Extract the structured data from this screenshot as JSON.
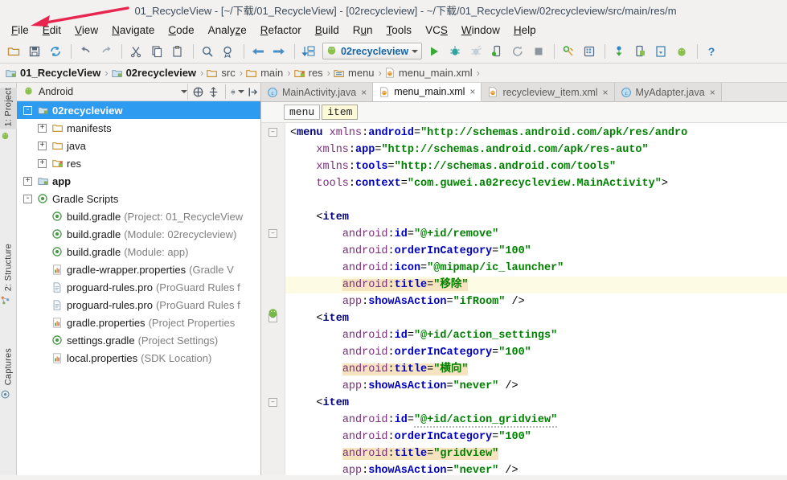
{
  "window": {
    "title": "01_RecycleView - [~/下载/01_RecycleView] - [02recycleview] - ~/下载/01_RecycleView/02recycleview/src/main/res/m"
  },
  "menubar": {
    "items": [
      {
        "label": "File",
        "mnemonic": "F"
      },
      {
        "label": "Edit",
        "mnemonic": "E"
      },
      {
        "label": "View",
        "mnemonic": "V"
      },
      {
        "label": "Navigate",
        "mnemonic": "N"
      },
      {
        "label": "Code",
        "mnemonic": "C"
      },
      {
        "label": "Analyze",
        "mnemonic": "z"
      },
      {
        "label": "Refactor",
        "mnemonic": "R"
      },
      {
        "label": "Build",
        "mnemonic": "B"
      },
      {
        "label": "Run",
        "mnemonic": "u"
      },
      {
        "label": "Tools",
        "mnemonic": "T"
      },
      {
        "label": "VCS",
        "mnemonic": "S"
      },
      {
        "label": "Window",
        "mnemonic": "W"
      },
      {
        "label": "Help",
        "mnemonic": "H"
      }
    ]
  },
  "toolbar": {
    "icons": [
      "open-folder-icon",
      "save-all-icon",
      "sync-refresh-icon",
      "undo-icon",
      "redo-icon",
      "cut-icon",
      "copy-icon",
      "paste-icon",
      "find-icon",
      "find-usages-icon",
      "back-icon",
      "forward-icon",
      "sort-icon"
    ],
    "run_config_label": "02recycleview",
    "right_icons": [
      "run-icon",
      "debug-icon",
      "coverage-icon",
      "attach-debugger-icon",
      "rerun-icon",
      "stop-icon",
      "sdk-manager-icon",
      "avd-manager-icon",
      "sync-gradle-icon",
      "device-explorer-icon",
      "layout-inspector-icon",
      "android-icon",
      "help-icon"
    ]
  },
  "breadcrumb": {
    "items": [
      {
        "label": "01_RecycleView",
        "icon": "module-icon",
        "bold": true
      },
      {
        "label": "02recycleview",
        "icon": "module-icon",
        "bold": true
      },
      {
        "label": "src",
        "icon": "folder-icon",
        "bold": false
      },
      {
        "label": "main",
        "icon": "folder-icon",
        "bold": false
      },
      {
        "label": "res",
        "icon": "res-folder-icon",
        "bold": false
      },
      {
        "label": "menu",
        "icon": "menu-folder-icon",
        "bold": false
      },
      {
        "label": "menu_main.xml",
        "icon": "xml-file-icon",
        "bold": false
      }
    ]
  },
  "toolstrip": {
    "items": [
      {
        "label": "1: Project",
        "icon": "android-icon",
        "active": true
      },
      {
        "label": "2: Structure",
        "icon": "structure-icon",
        "active": false
      },
      {
        "label": "Captures",
        "icon": "captures-icon",
        "active": false
      }
    ]
  },
  "project_panel": {
    "view_selector": "Android",
    "header_icons": [
      "collapse-all-icon",
      "expand-all-icon",
      "settings-gear-icon",
      "hide-panel-icon"
    ],
    "tree": [
      {
        "label": "02recycleview",
        "meta": "",
        "indent": 0,
        "toggle": "-",
        "icon": "module-icon",
        "selected": true,
        "bold": true
      },
      {
        "label": "manifests",
        "meta": "",
        "indent": 1,
        "toggle": "+",
        "icon": "folder-icon",
        "selected": false,
        "bold": false
      },
      {
        "label": "java",
        "meta": "",
        "indent": 1,
        "toggle": "+",
        "icon": "folder-icon",
        "selected": false,
        "bold": false
      },
      {
        "label": "res",
        "meta": "",
        "indent": 1,
        "toggle": "+",
        "icon": "res-folder-icon",
        "selected": false,
        "bold": false
      },
      {
        "label": "app",
        "meta": "",
        "indent": 0,
        "toggle": "+",
        "icon": "module-icon",
        "selected": false,
        "bold": true
      },
      {
        "label": "Gradle Scripts",
        "meta": "",
        "indent": 0,
        "toggle": "-",
        "icon": "gradle-icon",
        "selected": false,
        "bold": false
      },
      {
        "label": "build.gradle",
        "meta": "(Project: 01_RecycleView",
        "indent": 1,
        "toggle": "",
        "icon": "gradle-icon",
        "selected": false,
        "bold": false
      },
      {
        "label": "build.gradle",
        "meta": "(Module: 02recycleview)",
        "indent": 1,
        "toggle": "",
        "icon": "gradle-icon",
        "selected": false,
        "bold": false
      },
      {
        "label": "build.gradle",
        "meta": "(Module: app)",
        "indent": 1,
        "toggle": "",
        "icon": "gradle-icon",
        "selected": false,
        "bold": false
      },
      {
        "label": "gradle-wrapper.properties",
        "meta": "(Gradle V",
        "indent": 1,
        "toggle": "",
        "icon": "properties-icon",
        "selected": false,
        "bold": false
      },
      {
        "label": "proguard-rules.pro",
        "meta": "(ProGuard Rules f",
        "indent": 1,
        "toggle": "",
        "icon": "text-file-icon",
        "selected": false,
        "bold": false
      },
      {
        "label": "proguard-rules.pro",
        "meta": "(ProGuard Rules f",
        "indent": 1,
        "toggle": "",
        "icon": "text-file-icon",
        "selected": false,
        "bold": false
      },
      {
        "label": "gradle.properties",
        "meta": "(Project Properties",
        "indent": 1,
        "toggle": "",
        "icon": "properties-icon",
        "selected": false,
        "bold": false
      },
      {
        "label": "settings.gradle",
        "meta": "(Project Settings)",
        "indent": 1,
        "toggle": "",
        "icon": "gradle-icon",
        "selected": false,
        "bold": false
      },
      {
        "label": "local.properties",
        "meta": "(SDK Location)",
        "indent": 1,
        "toggle": "",
        "icon": "properties-icon",
        "selected": false,
        "bold": false
      }
    ]
  },
  "editor": {
    "tabs": [
      {
        "label": "MainActivity.java",
        "icon": "java-class-icon",
        "active": false,
        "close": "×"
      },
      {
        "label": "menu_main.xml",
        "icon": "xml-file-icon",
        "active": true,
        "close": "×"
      },
      {
        "label": "recycleview_item.xml",
        "icon": "xml-file-icon",
        "active": false,
        "close": "×"
      },
      {
        "label": "MyAdapter.java",
        "icon": "java-class-icon",
        "active": false,
        "close": "×"
      }
    ],
    "xml_breadcrumbs": [
      {
        "label": "menu",
        "highlighted": false
      },
      {
        "label": "item",
        "highlighted": true
      }
    ],
    "code_lines": [
      {
        "indent": 0,
        "parts": [
          {
            "t": "punct",
            "v": "<"
          },
          {
            "t": "tag",
            "v": "menu"
          },
          {
            "t": "plain",
            "v": " "
          },
          {
            "t": "ns",
            "v": "xmlns"
          },
          {
            "t": "punct",
            "v": ":"
          },
          {
            "t": "attrb",
            "v": "android"
          },
          {
            "t": "punct",
            "v": "="
          },
          {
            "t": "str",
            "v": "\"http://schemas.android.com/apk/res/andro"
          }
        ]
      },
      {
        "indent": 1,
        "parts": [
          {
            "t": "ns",
            "v": "xmlns"
          },
          {
            "t": "punct",
            "v": ":"
          },
          {
            "t": "attrb",
            "v": "app"
          },
          {
            "t": "punct",
            "v": "="
          },
          {
            "t": "str",
            "v": "\"http://schemas.android.com/apk/res-auto\""
          }
        ]
      },
      {
        "indent": 1,
        "parts": [
          {
            "t": "ns",
            "v": "xmlns"
          },
          {
            "t": "punct",
            "v": ":"
          },
          {
            "t": "attrb",
            "v": "tools"
          },
          {
            "t": "punct",
            "v": "="
          },
          {
            "t": "str",
            "v": "\"http://schemas.android.com/tools\""
          }
        ]
      },
      {
        "indent": 1,
        "parts": [
          {
            "t": "ns",
            "v": "tools"
          },
          {
            "t": "punct",
            "v": ":"
          },
          {
            "t": "attrb",
            "v": "context"
          },
          {
            "t": "punct",
            "v": "="
          },
          {
            "t": "str",
            "v": "\"com.guwei.a02recycleview.MainActivity\""
          },
          {
            "t": "punct",
            "v": ">"
          }
        ]
      },
      {
        "indent": 0,
        "parts": []
      },
      {
        "indent": 1,
        "parts": [
          {
            "t": "punct",
            "v": "<"
          },
          {
            "t": "tag",
            "v": "item"
          }
        ]
      },
      {
        "indent": 2,
        "parts": [
          {
            "t": "ns",
            "v": "android"
          },
          {
            "t": "punct",
            "v": ":"
          },
          {
            "t": "attrb",
            "v": "id"
          },
          {
            "t": "punct",
            "v": "="
          },
          {
            "t": "str",
            "v": "\"@+id/remove\""
          }
        ]
      },
      {
        "indent": 2,
        "parts": [
          {
            "t": "ns",
            "v": "android"
          },
          {
            "t": "punct",
            "v": ":"
          },
          {
            "t": "attrb",
            "v": "orderInCategory"
          },
          {
            "t": "punct",
            "v": "="
          },
          {
            "t": "str",
            "v": "\"100\""
          }
        ]
      },
      {
        "indent": 2,
        "parts": [
          {
            "t": "ns",
            "v": "android"
          },
          {
            "t": "punct",
            "v": ":"
          },
          {
            "t": "attrb",
            "v": "icon"
          },
          {
            "t": "punct",
            "v": "="
          },
          {
            "t": "str",
            "v": "\"@mipmap/ic_launcher\""
          }
        ]
      },
      {
        "indent": 2,
        "line_highlight": "soft",
        "parts": [
          {
            "t": "ns hl-tan",
            "v": "android"
          },
          {
            "t": "punct hl-tan",
            "v": ":"
          },
          {
            "t": "attrb hl-tan",
            "v": "title"
          },
          {
            "t": "punct hl-tan",
            "v": "="
          },
          {
            "t": "str hl-tan",
            "v": "\"移除\""
          }
        ]
      },
      {
        "indent": 2,
        "parts": [
          {
            "t": "ns",
            "v": "app"
          },
          {
            "t": "punct",
            "v": ":"
          },
          {
            "t": "attrb",
            "v": "showAsAction"
          },
          {
            "t": "punct",
            "v": "="
          },
          {
            "t": "str",
            "v": "\"ifRoom\""
          },
          {
            "t": "plain",
            "v": " "
          },
          {
            "t": "punct",
            "v": "/>"
          }
        ]
      },
      {
        "indent": 1,
        "parts": [
          {
            "t": "punct",
            "v": "<"
          },
          {
            "t": "tag",
            "v": "item"
          }
        ]
      },
      {
        "indent": 2,
        "parts": [
          {
            "t": "ns",
            "v": "android"
          },
          {
            "t": "punct",
            "v": ":"
          },
          {
            "t": "attrb",
            "v": "id"
          },
          {
            "t": "punct",
            "v": "="
          },
          {
            "t": "str",
            "v": "\"@+id/action_settings\""
          }
        ]
      },
      {
        "indent": 2,
        "parts": [
          {
            "t": "ns",
            "v": "android"
          },
          {
            "t": "punct",
            "v": ":"
          },
          {
            "t": "attrb",
            "v": "orderInCategory"
          },
          {
            "t": "punct",
            "v": "="
          },
          {
            "t": "str",
            "v": "\"100\""
          }
        ]
      },
      {
        "indent": 2,
        "parts": [
          {
            "t": "ns hl-tan",
            "v": "android"
          },
          {
            "t": "punct hl-tan",
            "v": ":"
          },
          {
            "t": "attrb hl-tan",
            "v": "title"
          },
          {
            "t": "punct hl-tan",
            "v": "="
          },
          {
            "t": "str hl-tan",
            "v": "\"横向\""
          }
        ]
      },
      {
        "indent": 2,
        "parts": [
          {
            "t": "ns",
            "v": "app"
          },
          {
            "t": "punct",
            "v": ":"
          },
          {
            "t": "attrb",
            "v": "showAsAction"
          },
          {
            "t": "punct",
            "v": "="
          },
          {
            "t": "str",
            "v": "\"never\""
          },
          {
            "t": "plain",
            "v": " "
          },
          {
            "t": "punct",
            "v": "/>"
          }
        ]
      },
      {
        "indent": 1,
        "parts": [
          {
            "t": "punct",
            "v": "<"
          },
          {
            "t": "tag",
            "v": "item"
          }
        ]
      },
      {
        "indent": 2,
        "parts": [
          {
            "t": "ns",
            "v": "android"
          },
          {
            "t": "punct",
            "v": ":"
          },
          {
            "t": "attrb",
            "v": "id"
          },
          {
            "t": "punct",
            "v": "="
          },
          {
            "t": "str squig",
            "v": "\"@+id/action_gridview\""
          }
        ]
      },
      {
        "indent": 2,
        "parts": [
          {
            "t": "ns",
            "v": "android"
          },
          {
            "t": "punct",
            "v": ":"
          },
          {
            "t": "attrb",
            "v": "orderInCategory"
          },
          {
            "t": "punct",
            "v": "="
          },
          {
            "t": "str",
            "v": "\"100\""
          }
        ]
      },
      {
        "indent": 2,
        "parts": [
          {
            "t": "ns hl-tan",
            "v": "android"
          },
          {
            "t": "punct hl-tan",
            "v": ":"
          },
          {
            "t": "attrb hl-tan",
            "v": "title"
          },
          {
            "t": "punct hl-tan",
            "v": "="
          },
          {
            "t": "str hl-tan",
            "v": "\"gridview\""
          }
        ]
      },
      {
        "indent": 2,
        "parts": [
          {
            "t": "ns",
            "v": "app"
          },
          {
            "t": "punct",
            "v": ":"
          },
          {
            "t": "attrb",
            "v": "showAsAction"
          },
          {
            "t": "punct",
            "v": "="
          },
          {
            "t": "str",
            "v": "\"never\""
          },
          {
            "t": "plain",
            "v": " "
          },
          {
            "t": "punct",
            "v": "/>"
          }
        ]
      }
    ]
  },
  "annotation": {
    "arrow_color": "#e8254f",
    "arrow_target": "File"
  },
  "colors": {
    "selection_blue": "#2d9bf0",
    "tag_navy": "#000080",
    "string_green": "#008000",
    "attr_purple": "#7a2e7a",
    "attr_blue": "#0000c0",
    "highlight_tan": "#f6e3c0",
    "line_highlight": "#fdfbe4",
    "run_config_blue": "#1565a8"
  }
}
